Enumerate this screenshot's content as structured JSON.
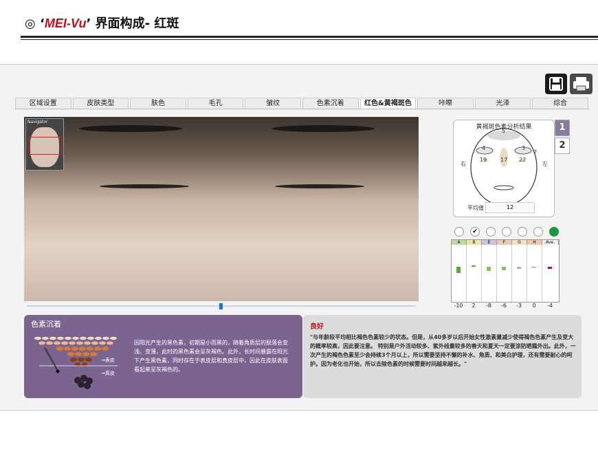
{
  "slide": {
    "symbol": "◎",
    "quote_open": "‘",
    "brand": "MEI-Vu",
    "quote_close": "’",
    "title_rest": " 界面构成- 红斑"
  },
  "tabs": [
    "区域设置",
    "皮肤类型",
    "肤色",
    "毛孔",
    "皱纹",
    "色素沉着",
    "红色&黄褐斑色",
    "咔嚓",
    "光泽",
    "综合"
  ],
  "active_tab_index": 6,
  "navigator_label": "Navigator",
  "analysis": {
    "title": "黄褐斑色素分析结果",
    "zones": [
      "5",
      "4",
      "3",
      "19",
      "17",
      "22",
      "7"
    ],
    "side_right": "右",
    "side_left": "左",
    "average_label": "平均值",
    "average_value": "12"
  },
  "pages": [
    "1",
    "2"
  ],
  "bar_headers": [
    "A",
    "B",
    "E",
    "F",
    "G",
    "H",
    "Ave."
  ],
  "bar_values": [
    "-10",
    "2",
    "-8",
    "-6",
    "-3",
    "0",
    "-4"
  ],
  "panel_left": {
    "title": "色素沉着",
    "text": "因阳光产生的黑色素，初期是小而黑的，随着角质层的脱落会变浅、变薄，此时的黑色素会呈灰褐色。此外，长时间暴露在阳光下产生黑色素，同时存在于表皮层和真皮层中，因此在皮肤表面看起来呈灰褐色的。",
    "label_epidermis": "→表皮",
    "label_dermis": "→真皮"
  },
  "panel_right": {
    "title": "良好",
    "text": "\"与年龄段平均相比褐色色素较少的状态。但是，从40多岁以后开始女性激素量减少使得褐色色素产生及变大的概率较高，因此要注意。 特别是户外活动较多、紫外线量较多的春天和夏天一定要涂防晒霜外出。此外，一次产生的褐色色素至少会持续3个月以上，所以需要坚持不懈的补水、角质、和美白护理，还有需要耐心的呵护。因为老化也开始，所以去除色素的时候需要时间越来越长。\""
  },
  "colors": {
    "brand_red": "#c0101a",
    "panel_purple": "#7c6490",
    "status_green": "#1a9640"
  }
}
